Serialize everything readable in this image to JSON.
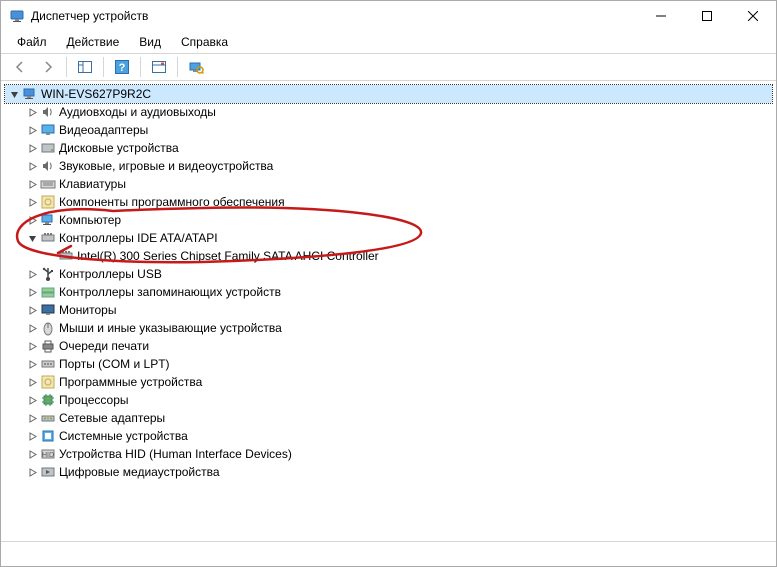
{
  "window": {
    "title": "Диспетчер устройств"
  },
  "menu": {
    "file": "Файл",
    "action": "Действие",
    "view": "Вид",
    "help": "Справка"
  },
  "tree": {
    "root": "WIN-EVS627P9R2C",
    "nodes": [
      {
        "label": "Аудиовходы и аудиовыходы",
        "icon": "speaker",
        "expanded": false
      },
      {
        "label": "Видеоадаптеры",
        "icon": "display",
        "expanded": false
      },
      {
        "label": "Дисковые устройства",
        "icon": "disk",
        "expanded": false
      },
      {
        "label": "Звуковые, игровые и видеоустройства",
        "icon": "speaker",
        "expanded": false
      },
      {
        "label": "Клавиатуры",
        "icon": "keyboard",
        "expanded": false
      },
      {
        "label": "Компоненты программного обеспечения",
        "icon": "software",
        "expanded": false
      },
      {
        "label": "Компьютер",
        "icon": "computer",
        "expanded": false
      },
      {
        "label": "Контроллеры IDE ATA/ATAPI",
        "icon": "controller",
        "expanded": true,
        "children": [
          {
            "label": "Intel(R) 300 Series Chipset Family SATA AHCI Controller",
            "icon": "controller"
          }
        ]
      },
      {
        "label": "Контроллеры USB",
        "icon": "usb",
        "expanded": false
      },
      {
        "label": "Контроллеры запоминающих устройств",
        "icon": "storagectl",
        "expanded": false
      },
      {
        "label": "Мониторы",
        "icon": "monitor",
        "expanded": false
      },
      {
        "label": "Мыши и иные указывающие устройства",
        "icon": "mouse",
        "expanded": false
      },
      {
        "label": "Очереди печати",
        "icon": "printer",
        "expanded": false
      },
      {
        "label": "Порты (COM и LPT)",
        "icon": "port",
        "expanded": false
      },
      {
        "label": "Программные устройства",
        "icon": "software",
        "expanded": false
      },
      {
        "label": "Процессоры",
        "icon": "cpu",
        "expanded": false
      },
      {
        "label": "Сетевые адаптеры",
        "icon": "network",
        "expanded": false
      },
      {
        "label": "Системные устройства",
        "icon": "system",
        "expanded": false
      },
      {
        "label": "Устройства HID (Human Interface Devices)",
        "icon": "hid",
        "expanded": false
      },
      {
        "label": "Цифровые медиаустройства",
        "icon": "media",
        "expanded": false
      }
    ]
  },
  "annotation": {
    "color": "#c61a1a"
  }
}
